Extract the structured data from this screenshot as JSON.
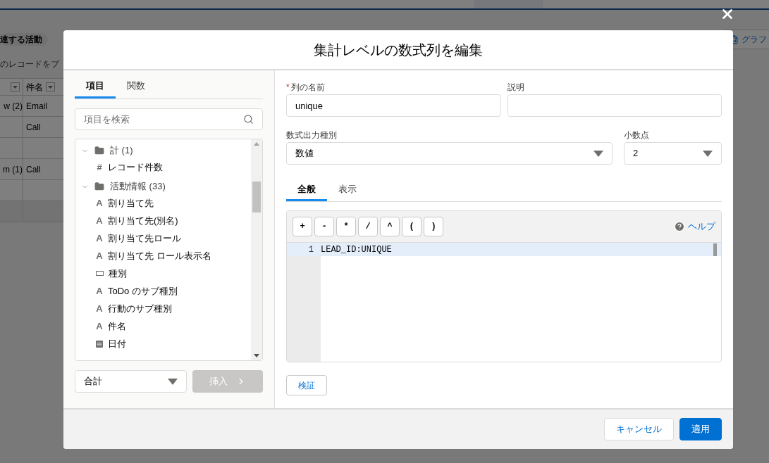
{
  "background": {
    "chip": "連する活動",
    "notice": "のレコードをプ",
    "chart_button": "グラフ",
    "table": {
      "header": "件名",
      "rows": [
        [
          "w (2)",
          "Email"
        ],
        [
          null,
          "Call"
        ],
        [
          null,
          null
        ],
        [
          "m (1)",
          "Call"
        ],
        [
          null,
          null
        ],
        [
          null,
          null
        ]
      ]
    }
  },
  "dialog": {
    "title": "集計レベルの数式列を編集",
    "left_panel": {
      "tabs": [
        {
          "label": "項目",
          "selected": true
        },
        {
          "label": "関数",
          "selected": false
        }
      ],
      "search": {
        "placeholder": "項目を検索"
      },
      "tree": [
        {
          "label": "計 (1)",
          "expanded": true,
          "children": [
            {
              "label": "レコード件数",
              "kind": "number",
              "glyph": "#"
            }
          ]
        },
        {
          "label": "活動情報 (33)",
          "expanded": true,
          "children": [
            {
              "label": "割り当て先",
              "kind": "text",
              "glyph": "A"
            },
            {
              "label": "割り当て先(別名)",
              "kind": "text",
              "glyph": "A"
            },
            {
              "label": "割り当て先ロール",
              "kind": "text",
              "glyph": "A"
            },
            {
              "label": "割り当て先 ロール表示名",
              "kind": "text",
              "glyph": "A"
            },
            {
              "label": "種別",
              "kind": "picklist"
            },
            {
              "label": "ToDo のサブ種別",
              "kind": "text",
              "glyph": "A"
            },
            {
              "label": "行動のサブ種別",
              "kind": "text",
              "glyph": "A"
            },
            {
              "label": "件名",
              "kind": "text",
              "glyph": "A"
            },
            {
              "label": "日付",
              "kind": "date"
            }
          ]
        }
      ],
      "summary_select": {
        "value": "合計"
      },
      "insert_button": {
        "label": "挿入",
        "disabled": true
      }
    },
    "form": {
      "column_name": {
        "label": "列の名前",
        "required": true,
        "value": "unique"
      },
      "description": {
        "label": "説明"
      },
      "output_type": {
        "label": "数式出力種別",
        "value": "数値"
      },
      "decimals": {
        "label": "小数点",
        "value": "2"
      },
      "tabs": [
        {
          "label": "全般",
          "selected": true
        },
        {
          "label": "表示",
          "selected": false
        }
      ],
      "operators": [
        "+",
        "-",
        "*",
        "/",
        "^",
        "(",
        ")"
      ],
      "help": "ヘルプ",
      "editor_lines": [
        {
          "number": "1",
          "text": "LEAD_ID:UNIQUE",
          "selected": true
        }
      ],
      "validate_button": "検証"
    },
    "footer_buttons": [
      {
        "label": "キャンセル",
        "kind": "neutral"
      },
      {
        "label": "適用",
        "kind": "brand"
      }
    ]
  }
}
